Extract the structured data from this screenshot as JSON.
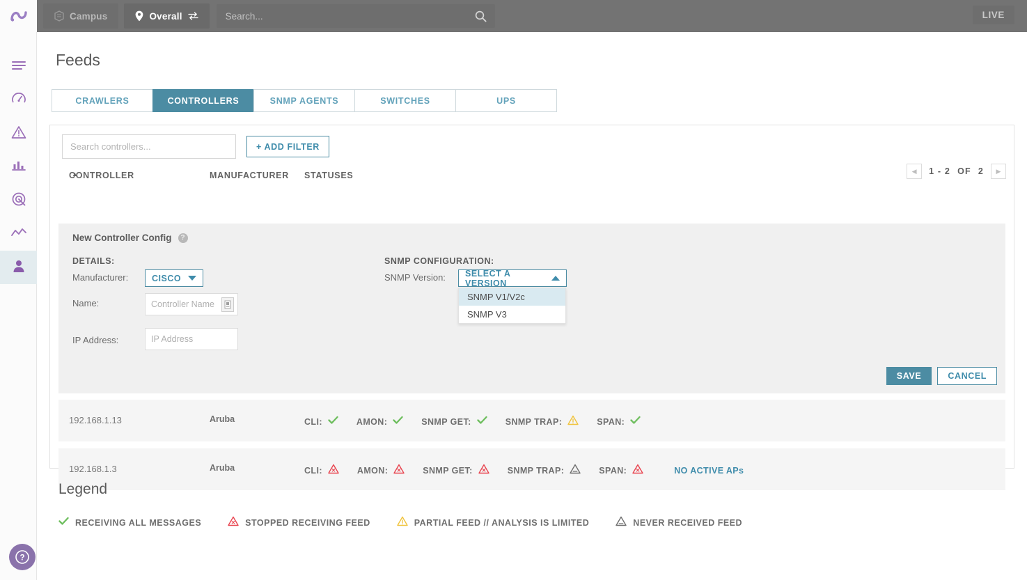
{
  "header": {
    "campus_label": "Campus",
    "overall_label": "Overall",
    "search_placeholder": "Search...",
    "live_label": "LIVE",
    "icons": {
      "logo": "brand-logo-icon",
      "campus": "building-icon",
      "overall": "location-pin-icon",
      "swap": "swap-arrows-icon",
      "search": "search-icon"
    }
  },
  "rail": {
    "items": [
      {
        "name": "menu-icon"
      },
      {
        "name": "gauge-icon"
      },
      {
        "name": "alert-triangle-icon"
      },
      {
        "name": "bar-chart-icon"
      },
      {
        "name": "radar-target-icon"
      },
      {
        "name": "line-chart-icon"
      },
      {
        "name": "user-icon"
      }
    ],
    "help_label": "?"
  },
  "page": {
    "title": "Feeds"
  },
  "tabs": [
    {
      "label": "CRAWLERS",
      "active": false
    },
    {
      "label": "CONTROLLERS",
      "active": true
    },
    {
      "label": "SNMP AGENTS",
      "active": false
    },
    {
      "label": "SWITCHES",
      "active": false
    },
    {
      "label": "UPS",
      "active": false
    }
  ],
  "toolbar": {
    "search_placeholder": "Search controllers...",
    "search_value": "",
    "add_filter_label": "+ ADD FILTER"
  },
  "columns": {
    "controller": "CONTROLLER",
    "sort_caret": "▲",
    "manufacturer": "MANUFACTURER",
    "statuses": "STATUSES"
  },
  "pagination": {
    "prev": "◀",
    "next": "▶",
    "range": "1 - 2",
    "of": "OF",
    "total": "2"
  },
  "config": {
    "title": "New Controller Config",
    "help_glyph": "?",
    "details_label": "DETAILS:",
    "manufacturer_label": "Manufacturer:",
    "manufacturer_value": "CISCO",
    "name_label": "Name:",
    "name_placeholder": "Controller Name",
    "name_value": "",
    "ip_label": "IP Address:",
    "ip_placeholder": "IP Address",
    "ip_value": "",
    "snmp_section_label": "SNMP CONFIGURATION:",
    "snmp_version_label": "SNMP Version:",
    "snmp_version_value": "SELECT A VERSION",
    "snmp_options": [
      {
        "label": "SNMP V1/V2c",
        "highlighted": true
      },
      {
        "label": "SNMP V3",
        "highlighted": false
      }
    ],
    "save_label": "SAVE",
    "cancel_label": "CANCEL"
  },
  "rows": [
    {
      "ip": "192.168.1.13",
      "manufacturer": "Aruba",
      "note": "",
      "statuses": [
        {
          "label": "CLI:",
          "state": "ok"
        },
        {
          "label": "AMON:",
          "state": "ok"
        },
        {
          "label": "SNMP GET:",
          "state": "ok"
        },
        {
          "label": "SNMP TRAP:",
          "state": "partial"
        },
        {
          "label": "SPAN:",
          "state": "ok"
        }
      ]
    },
    {
      "ip": "192.168.1.3",
      "manufacturer": "Aruba",
      "note": "NO ACTIVE APs",
      "statuses": [
        {
          "label": "CLI:",
          "state": "stopped"
        },
        {
          "label": "AMON:",
          "state": "stopped"
        },
        {
          "label": "SNMP GET:",
          "state": "stopped"
        },
        {
          "label": "SNMP TRAP:",
          "state": "never"
        },
        {
          "label": "SPAN:",
          "state": "stopped"
        }
      ]
    }
  ],
  "legend": {
    "title": "Legend",
    "items": [
      {
        "label": "RECEIVING ALL MESSAGES",
        "state": "ok"
      },
      {
        "label": "STOPPED RECEIVING FEED",
        "state": "stopped"
      },
      {
        "label": "PARTIAL FEED // ANALYSIS IS LIMITED",
        "state": "partial"
      },
      {
        "label": "NEVER RECEIVED FEED",
        "state": "never"
      }
    ]
  },
  "colors": {
    "accent": "#4c8ca3",
    "brand_purple": "#8a72ab",
    "ok": "#6ebe5e",
    "stopped": "#e8444f",
    "partial": "#f0c33c",
    "never": "#6e6e6e",
    "topbar": "#737373"
  }
}
